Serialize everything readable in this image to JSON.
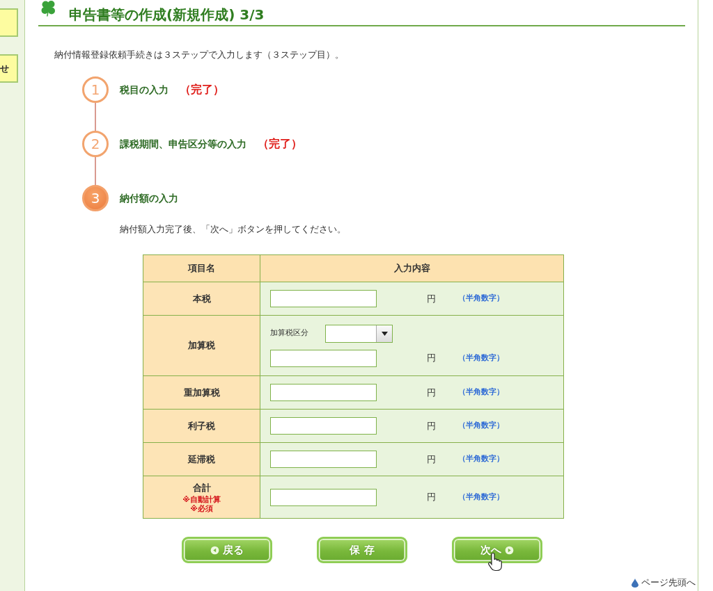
{
  "sidebar": {
    "buttons": [
      {
        "kind": "blank"
      },
      {
        "kind": "text",
        "label": "せ"
      }
    ]
  },
  "page": {
    "title": "申告書等の作成(新規作成) 3/3",
    "intro": "納付情報登録依頼手続きは３ステップで入力します（３ステップ目）。"
  },
  "steps": [
    {
      "number": "1",
      "label": "税目の入力",
      "status": "（完了）",
      "current": false
    },
    {
      "number": "2",
      "label": "課税期間、申告区分等の入力",
      "status": "（完了）",
      "current": false
    },
    {
      "number": "3",
      "label": "納付額の入力",
      "current": true,
      "note": "納付額入力完了後、「次へ」ボタンを押してください。"
    }
  ],
  "table": {
    "columns": [
      "項目名",
      "入力内容"
    ],
    "rows": [
      {
        "kind": "amount",
        "label": "本税",
        "unit": "円",
        "hint": "（半角数字）"
      },
      {
        "kind": "select",
        "label": "加算税",
        "select_label": "加算税区分",
        "unit": "円",
        "hint": "（半角数字）"
      },
      {
        "kind": "amount",
        "label": "重加算税",
        "unit": "円",
        "hint": "（半角数字）"
      },
      {
        "kind": "amount",
        "label": "利子税",
        "unit": "円",
        "hint": "（半角数字）"
      },
      {
        "kind": "amount",
        "label": "延滞税",
        "unit": "円",
        "hint": "（半角数字）"
      },
      {
        "kind": "amount",
        "label": "合計",
        "notes": [
          "※自動計算",
          "※必須"
        ],
        "unit": "円",
        "hint": "（半角数字）"
      }
    ]
  },
  "buttons": [
    {
      "kind": "back",
      "label": "戻る"
    },
    {
      "kind": "save",
      "label": "保 存"
    },
    {
      "kind": "next",
      "label": "次へ"
    }
  ],
  "page_top_link": "ページ先頭へ"
}
